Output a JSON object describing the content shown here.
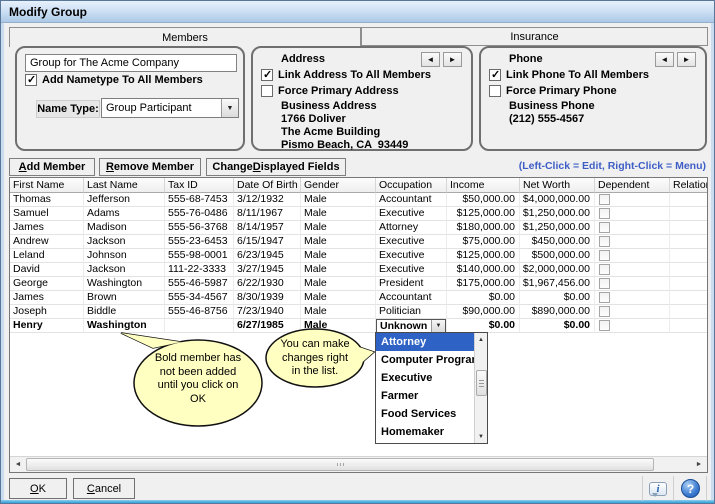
{
  "window": {
    "title": "Modify Group"
  },
  "tabs": {
    "members": "Members",
    "insurance": "Insurance"
  },
  "group_panel": {
    "name_value": "Group for The Acme Company",
    "add_nametype_label": "Add Nametype To All Members",
    "add_nametype_checked": true,
    "name_type_label": "Name Type:",
    "name_type_value": "Group Participant"
  },
  "address_panel": {
    "title": "Address",
    "link_label": "Link Address To All Members",
    "link_checked": true,
    "force_label": "Force Primary Address",
    "force_checked": false,
    "type": "Business Address",
    "line1": "1766 Doliver",
    "line2": "The Acme Building",
    "line3": "Pismo Beach, CA  93449"
  },
  "phone_panel": {
    "title": "Phone",
    "link_label": "Link Phone To All Members",
    "link_checked": true,
    "force_label": "Force Primary Phone",
    "force_checked": false,
    "type": "Business Phone",
    "number": "(212) 555-4567"
  },
  "toolbar": {
    "add_label": "Add Member",
    "remove_label": "Remove Member",
    "change_label": "Change Displayed Fields",
    "hint": "(Left-Click = Edit, Right-Click = Menu)"
  },
  "grid": {
    "columns": [
      "First Name",
      "Last Name",
      "Tax ID",
      "Date Of Birth",
      "Gender",
      "Occupation",
      "Income",
      "Net Worth",
      "Dependent",
      "Relation"
    ],
    "rows": [
      {
        "first": "Thomas",
        "last": "Jefferson",
        "tax": "555-68-7453",
        "dob": "3/12/1932",
        "gender": "Male",
        "occupation": "Accountant",
        "income": "$50,000.00",
        "networth": "$4,000,000.00",
        "dependent": false,
        "relation": ""
      },
      {
        "first": "Samuel",
        "last": "Adams",
        "tax": "555-76-0486",
        "dob": "8/11/1967",
        "gender": "Male",
        "occupation": "Executive",
        "income": "$125,000.00",
        "networth": "$1,250,000.00",
        "dependent": false,
        "relation": ""
      },
      {
        "first": "James",
        "last": "Madison",
        "tax": "555-56-3768",
        "dob": "8/14/1957",
        "gender": "Male",
        "occupation": "Attorney",
        "income": "$180,000.00",
        "networth": "$1,250,000.00",
        "dependent": false,
        "relation": ""
      },
      {
        "first": "Andrew",
        "last": "Jackson",
        "tax": "555-23-6453",
        "dob": "6/15/1947",
        "gender": "Male",
        "occupation": "Executive",
        "income": "$75,000.00",
        "networth": "$450,000.00",
        "dependent": false,
        "relation": ""
      },
      {
        "first": "Leland",
        "last": "Johnson",
        "tax": "555-98-0001",
        "dob": "6/23/1945",
        "gender": "Male",
        "occupation": "Executive",
        "income": "$125,000.00",
        "networth": "$500,000.00",
        "dependent": false,
        "relation": ""
      },
      {
        "first": "David",
        "last": "Jackson",
        "tax": "111-22-3333",
        "dob": "3/27/1945",
        "gender": "Male",
        "occupation": "Executive",
        "income": "$140,000.00",
        "networth": "$2,000,000.00",
        "dependent": false,
        "relation": ""
      },
      {
        "first": "George",
        "last": "Washington",
        "tax": "555-46-5987",
        "dob": "6/22/1930",
        "gender": "Male",
        "occupation": "President",
        "income": "$175,000.00",
        "networth": "$1,967,456.00",
        "dependent": false,
        "relation": ""
      },
      {
        "first": "James",
        "last": "Brown",
        "tax": "555-34-4567",
        "dob": "8/30/1939",
        "gender": "Male",
        "occupation": "Accountant",
        "income": "$0.00",
        "networth": "$0.00",
        "dependent": false,
        "relation": ""
      },
      {
        "first": "Joseph",
        "last": "Biddle",
        "tax": "555-46-8756",
        "dob": "7/23/1940",
        "gender": "Male",
        "occupation": "Politician",
        "income": "$90,000.00",
        "networth": "$890,000.00",
        "dependent": false,
        "relation": ""
      }
    ],
    "pending_row": {
      "first": "Henry",
      "last": "Washington",
      "tax": "",
      "dob": "6/27/1985",
      "gender": "Male",
      "occupation": "Unknown",
      "income": "$0.00",
      "networth": "$0.00",
      "dependent": false,
      "relation": ""
    }
  },
  "occupation_dropdown": {
    "value": "Unknown",
    "options": [
      "Attorney",
      "Computer Programmer",
      "Executive",
      "Farmer",
      "Food Services",
      "Homemaker"
    ],
    "highlighted": "Attorney"
  },
  "callouts": {
    "bold_member": "Bold member has\nnot been added\nuntil you click on\nOK",
    "inline_edit": "You can make\nchanges right\nin the list."
  },
  "footer": {
    "ok_label": "OK",
    "cancel_label": "Cancel"
  },
  "icons": {
    "left-arrow": "◄",
    "right-arrow": "►",
    "dropdown-arrow": "▼",
    "up-arrow": "▲",
    "down-arrow": "▼",
    "scroll-left": "◄",
    "scroll-right": "►",
    "info": "i",
    "help": "?"
  },
  "colors": {
    "selection_blue": "#2E63C5",
    "hint_blue": "#3E5EC6",
    "callout_yellow": "#FFFFC2",
    "titlebar_top": "#E6F1FC",
    "titlebar_bottom": "#ABC8E6"
  }
}
